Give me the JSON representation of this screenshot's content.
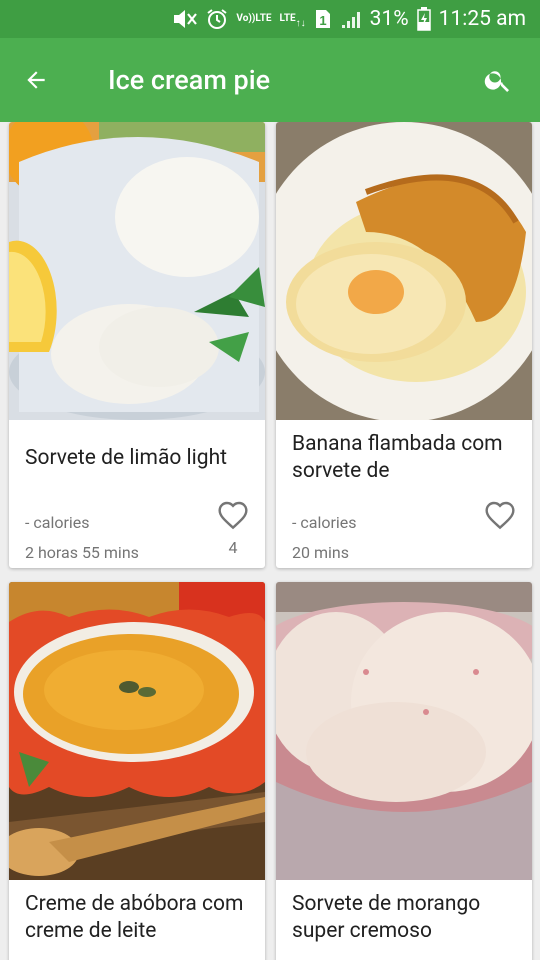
{
  "status_bar": {
    "lte_label": "LTE",
    "vol_label": "Vo))",
    "sim_number": "1",
    "battery_percent": "31%",
    "time": "11:25 am"
  },
  "app_bar": {
    "title": "Ice cream pie",
    "back_icon": "arrow-back-icon",
    "search_icon": "search-icon"
  },
  "recipes": [
    {
      "title": "Sorvete de limão light",
      "calories": "- calories",
      "time": "2 horas 55 mins",
      "likes": "4"
    },
    {
      "title": "Banana flambada com sorvete de",
      "calories": "- calories",
      "time": "20 mins",
      "likes": ""
    },
    {
      "title": "Creme de abóbora com creme de leite",
      "calories": "",
      "time": "",
      "likes": ""
    },
    {
      "title": "Sorvete de morango super cremoso",
      "calories": "",
      "time": "",
      "likes": ""
    }
  ],
  "colors": {
    "status_bar": "#3f9e43",
    "app_bar": "#4caf50",
    "background": "#eeeeee"
  }
}
